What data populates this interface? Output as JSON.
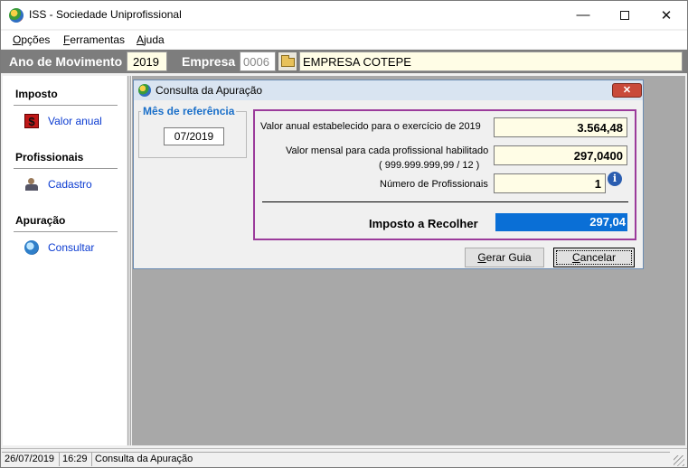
{
  "window": {
    "title": "ISS - Sociedade Uniprofissional",
    "controls": {
      "minimize": "—",
      "close": "✕"
    }
  },
  "menu": {
    "items": [
      {
        "label": "Opções",
        "access_key": "O"
      },
      {
        "label": "Ferramentas",
        "access_key": "F"
      },
      {
        "label": "Ajuda",
        "access_key": "A"
      }
    ]
  },
  "context_bar": {
    "year_label": "Ano de Movimento",
    "year_value": "2019",
    "company_label": "Empresa",
    "company_code": "0006",
    "company_name": "EMPRESA COTEPE"
  },
  "sidebar": {
    "sections": [
      {
        "title": "Imposto",
        "items": [
          {
            "label": "Valor anual",
            "icon": "money-icon"
          }
        ]
      },
      {
        "title": "Profissionais",
        "items": [
          {
            "label": "Cadastro",
            "icon": "person-icon"
          }
        ]
      },
      {
        "title": "Apuração",
        "items": [
          {
            "label": "Consultar",
            "icon": "globe-icon"
          }
        ]
      }
    ]
  },
  "dialog": {
    "title": "Consulta da Apuração",
    "close_label": "✕",
    "reference_group_title": "Mês de referência",
    "reference_month": "07/2019",
    "annual_label": "Valor anual estabelecido para o exercício de  2019",
    "annual_value": "3.564,48",
    "monthly_label": "Valor mensal para cada profissional habilitado",
    "monthly_formula": "( 999.999.999,99 / 12 )",
    "monthly_value": "297,0400",
    "professionals_label": "Número de Profissionais",
    "professionals_value": "1",
    "info_symbol": "i",
    "tax_label": "Imposto a Recolher",
    "tax_value": "297,04",
    "buttons": {
      "generate": {
        "label": "Gerar Guia",
        "access_key": "G"
      },
      "cancel": {
        "label": "Cancelar",
        "access_key": "C"
      }
    }
  },
  "statusbar": {
    "date": "26/07/2019",
    "time": "16:29",
    "message": "Consulta da Apuração"
  },
  "colors": {
    "highlight_border": "#9b3b9b",
    "tax_field": "#0a6fd6",
    "link": "#0b3bd1",
    "group_title": "#1a6fc9"
  }
}
